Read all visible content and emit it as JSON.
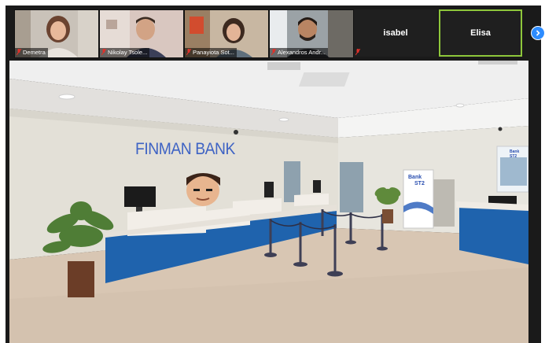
{
  "participants": [
    {
      "name": "Demetra",
      "muted": true,
      "type": "video"
    },
    {
      "name": "Nikolay Tsole...",
      "muted": true,
      "type": "video"
    },
    {
      "name": "Panayiota Sot...",
      "muted": true,
      "type": "video"
    },
    {
      "name": "Alexandros Andr...",
      "muted": true,
      "type": "video"
    },
    {
      "name": "isabel",
      "type": "text"
    },
    {
      "name": "Elisa",
      "type": "text",
      "active": true
    }
  ],
  "scene": {
    "bank_sign": "FINMAN BANK",
    "banner_line1": "Bank",
    "banner_line2": "ST2",
    "poster_line1": "Bank",
    "poster_line2": "ST2"
  },
  "colors": {
    "active_speaker": "#8ec73b",
    "accent": "#2d8cff",
    "muted": "#e0312a",
    "counter_blue": "#1f63ad"
  }
}
